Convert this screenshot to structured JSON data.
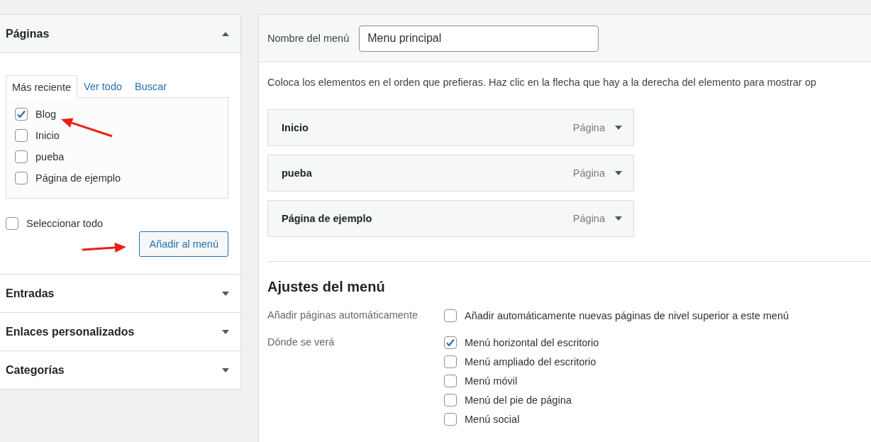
{
  "sidebar": {
    "sections": [
      {
        "title": "Páginas",
        "expanded": true,
        "tabs": [
          {
            "label": "Más reciente",
            "selected": true
          },
          {
            "label": "Ver todo",
            "selected": false
          },
          {
            "label": "Buscar",
            "selected": false
          }
        ],
        "items": [
          {
            "label": "Blog",
            "checked": true
          },
          {
            "label": "Inicio",
            "checked": false
          },
          {
            "label": "pueba",
            "checked": false
          },
          {
            "label": "Página de ejemplo",
            "checked": false
          }
        ],
        "select_all": {
          "label": "Seleccionar todo",
          "checked": false
        },
        "button": "Añadir al menú"
      },
      {
        "title": "Entradas",
        "expanded": false
      },
      {
        "title": "Enlaces personalizados",
        "expanded": false
      },
      {
        "title": "Categorías",
        "expanded": false
      }
    ]
  },
  "menu_editor": {
    "name_label": "Nombre del menú",
    "name_value": "Menu principal",
    "instructions": "Coloca los elementos en el orden que prefieras. Haz clic en la flecha que hay a la derecha del elemento para mostrar op",
    "items": [
      {
        "title": "Inicio",
        "type": "Página"
      },
      {
        "title": "pueba",
        "type": "Página"
      },
      {
        "title": "Página de ejemplo",
        "type": "Página"
      }
    ],
    "settings": {
      "heading": "Ajustes del menú",
      "auto_add": {
        "label": "Añadir páginas automáticamente",
        "option": {
          "label": "Añadir automáticamente nuevas páginas de nivel superior a este menú",
          "checked": false
        }
      },
      "locations": {
        "label": "Dónde se verá",
        "options": [
          {
            "label": "Menú horizontal del escritorio",
            "checked": true
          },
          {
            "label": "Menú ampliado del escritorio",
            "checked": false
          },
          {
            "label": "Menú móvil",
            "checked": false
          },
          {
            "label": "Menú del pie de página",
            "checked": false
          },
          {
            "label": "Menú social",
            "checked": false
          }
        ]
      }
    }
  },
  "annotations": [
    {
      "kind": "arrow"
    },
    {
      "kind": "arrow"
    }
  ]
}
